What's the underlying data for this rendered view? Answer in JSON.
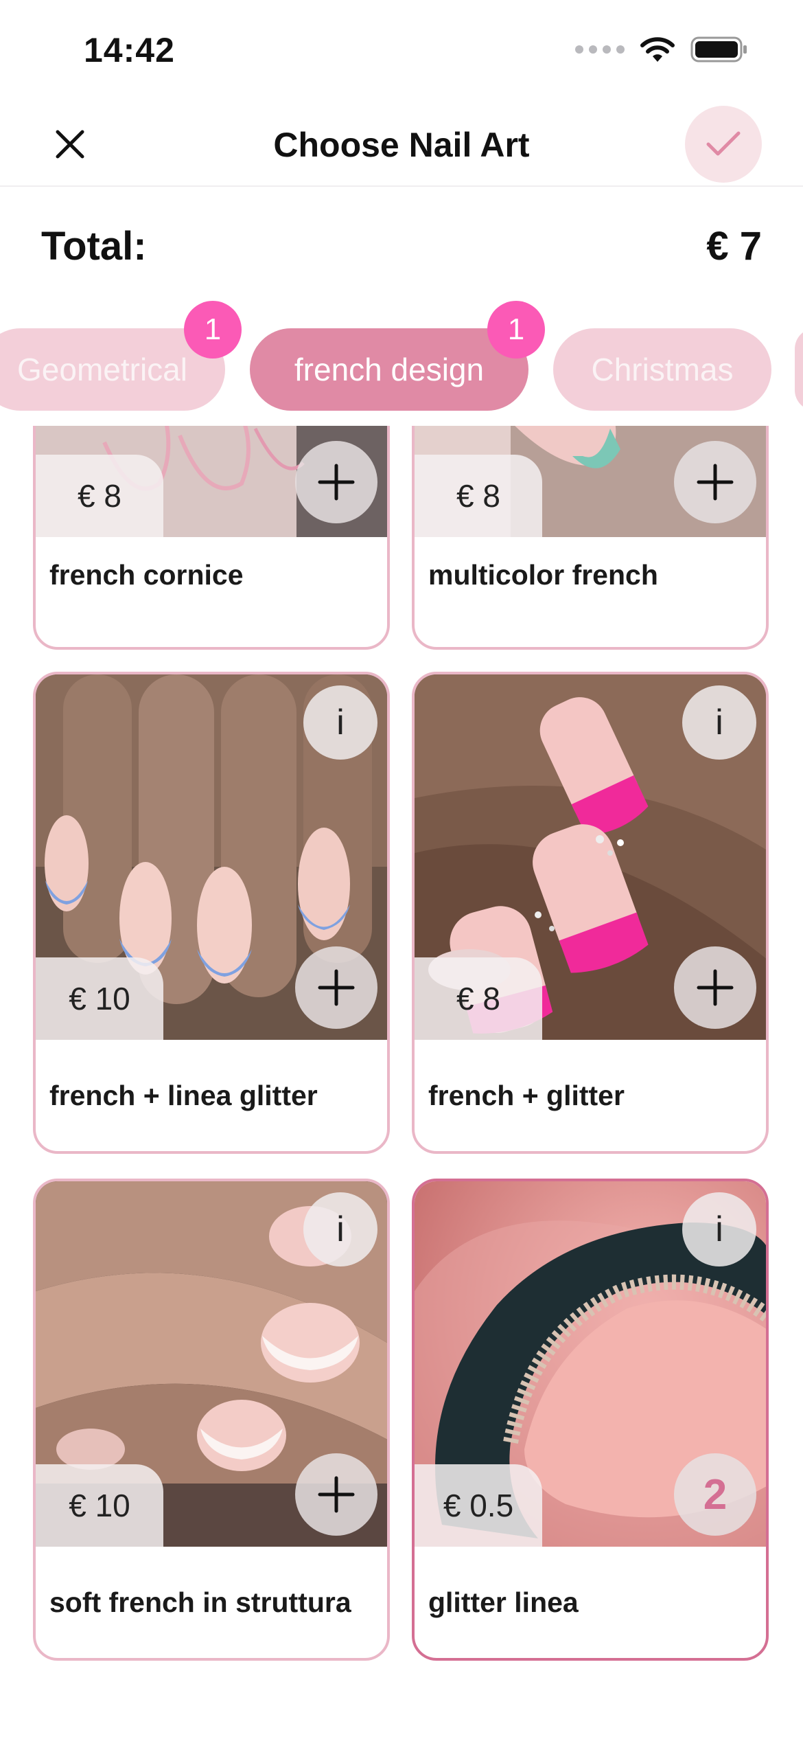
{
  "status_bar": {
    "time": "14:42"
  },
  "header": {
    "title": "Choose Nail Art"
  },
  "total": {
    "label": "Total:",
    "value": "€ 7"
  },
  "tabs": [
    {
      "label": "Geometrical",
      "badge": "1",
      "active": false
    },
    {
      "label": "french design",
      "badge": "1",
      "active": true
    },
    {
      "label": "Christmas",
      "active": false
    }
  ],
  "items": [
    {
      "name": "french cornice",
      "price": "€ 8"
    },
    {
      "name": "multicolor french",
      "price": "€ 8"
    },
    {
      "name": "french + linea glitter",
      "price": "€ 10",
      "info": "i"
    },
    {
      "name": "french + glitter",
      "price": "€ 8",
      "info": "i"
    },
    {
      "name": "soft french in struttura",
      "price": "€ 10",
      "info": "i"
    },
    {
      "name": "glitter linea",
      "price": "€ 0.5",
      "info": "i",
      "quantity": "2",
      "selected": true
    }
  ],
  "colors": {
    "accent": "#e08aa5",
    "badge": "#fb5ab6",
    "card_border": "#eab7c7",
    "card_border_selected": "#d46f93",
    "tab_pale": "#f3cfd9",
    "confirm_bg": "#f7e3e7"
  },
  "icons": {
    "close": "close-icon",
    "confirm": "checkmark-icon",
    "add": "plus-icon",
    "info": "info-icon",
    "wifi": "wifi-icon",
    "battery": "battery-icon",
    "signal": "cellular-signal-icon"
  }
}
